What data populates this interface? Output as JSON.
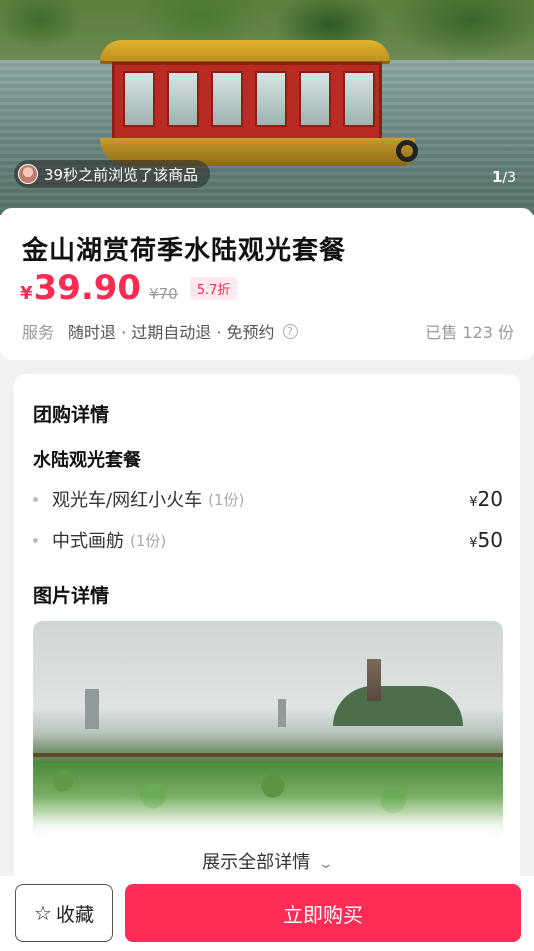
{
  "hero": {
    "viewer_text": "39秒之前浏览了该商品",
    "page_current": "1",
    "page_total": "/3"
  },
  "product": {
    "title": "金山湖赏荷季水陆观光套餐",
    "currency": "¥",
    "price": "39.90",
    "original_price": "¥70",
    "discount": "5.7折",
    "service_label": "服务",
    "services": "随时退 · 过期自动退 · 免预约",
    "sold": "已售 123 份"
  },
  "details": {
    "section_title": "团购详情",
    "package_title": "水陆观光套餐",
    "items": [
      {
        "name": "观光车/网红小火车",
        "qty": "(1份)",
        "currency": "¥",
        "price": "20"
      },
      {
        "name": "中式画舫",
        "qty": "(1份)",
        "currency": "¥",
        "price": "50"
      }
    ],
    "photo_section_title": "图片详情",
    "expand_label": "展示全部详情"
  },
  "bottom_bar": {
    "favorite_label": "收藏",
    "buy_label": "立即购买"
  },
  "colors": {
    "accent": "#ff2d55",
    "price": "#ff2b52"
  }
}
